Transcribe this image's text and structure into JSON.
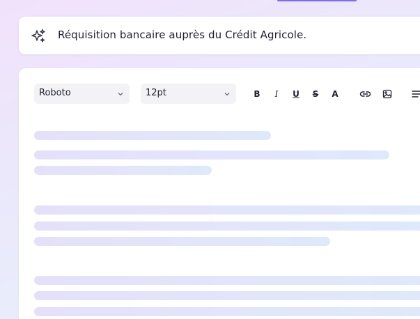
{
  "prompt": {
    "icon": "sparkle-icon",
    "text": "Réquisition bancaire auprès du Crédit Agricole."
  },
  "toolbar": {
    "font_family": "Roboto",
    "font_size": "12pt",
    "bold_label": "B",
    "italic_label": "I",
    "underline_label": "U",
    "strike_label": "S",
    "text_color_label": "A",
    "icons": [
      "chevron-down-icon",
      "link-icon",
      "image-icon",
      "align-icon"
    ]
  },
  "colors": {
    "accent": "#7b6cf0",
    "skeleton": "#e3e4fa",
    "text": "#1f1f2e"
  }
}
